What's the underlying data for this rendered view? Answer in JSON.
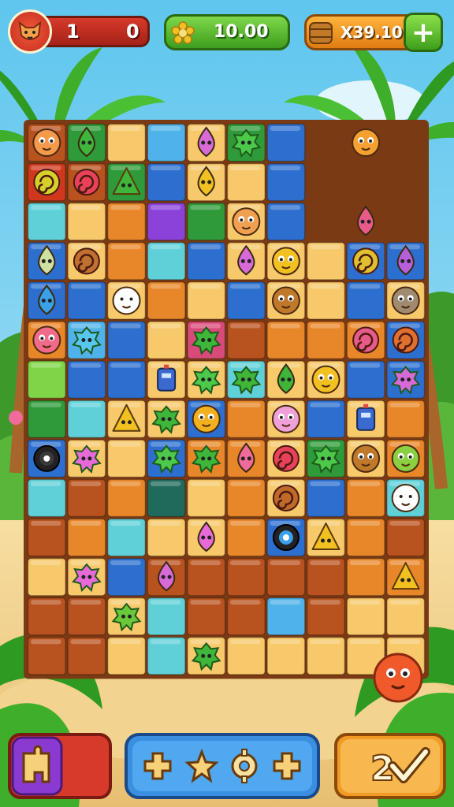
{
  "hud": {
    "player_level": "1",
    "player_score": "0",
    "timer": "10.00",
    "coins": "X39.10",
    "add_label": "+"
  },
  "colors": {
    "sky": "#5fc6ee",
    "sand": "#f2d38f",
    "board_border": "#8a4a1c",
    "accent_red": "#d63a2a",
    "accent_green": "#4fb52a",
    "accent_orange": "#f29b24",
    "accent_blue": "#3a8fe0"
  },
  "board": {
    "cols": 10,
    "rows": 14,
    "tiles": [
      [
        "brick",
        "green",
        "sand",
        "sky",
        "sand",
        "green",
        "blue",
        "empty",
        "empty",
        "empty"
      ],
      [
        "red",
        "brick",
        "green",
        "blue",
        "sand",
        "sand",
        "blue",
        "empty",
        "empty",
        "empty"
      ],
      [
        "cyan",
        "sand",
        "orange",
        "purple",
        "green",
        "sand",
        "blue",
        "empty",
        "empty",
        "empty"
      ],
      [
        "blue",
        "sand",
        "orange",
        "cyan",
        "blue",
        "sand",
        "sand",
        "sand",
        "blue",
        "blue"
      ],
      [
        "blue",
        "blue",
        "sand",
        "orange",
        "sand",
        "blue",
        "sand",
        "sand",
        "blue",
        "sand"
      ],
      [
        "orange",
        "sky",
        "blue",
        "sand",
        "pink",
        "brick",
        "orange",
        "orange",
        "orange",
        "blue"
      ],
      [
        "lime",
        "blue",
        "blue",
        "sand",
        "sand",
        "cyan",
        "sand",
        "sand",
        "blue",
        "blue"
      ],
      [
        "green",
        "cyan",
        "sand",
        "sand",
        "blue",
        "orange",
        "sand",
        "blue",
        "sand",
        "orange"
      ],
      [
        "blue",
        "sand",
        "sand",
        "blue",
        "orange",
        "orange",
        "sand",
        "green",
        "sand",
        "orange"
      ],
      [
        "cyan",
        "brick",
        "orange",
        "teal",
        "sand",
        "orange",
        "sand",
        "blue",
        "orange",
        "cyan"
      ],
      [
        "brick",
        "orange",
        "cyan",
        "sand",
        "sand",
        "orange",
        "blue",
        "sand",
        "orange",
        "brick"
      ],
      [
        "sand",
        "sand",
        "blue",
        "brick",
        "brick",
        "brick",
        "brick",
        "brick",
        "orange",
        "orange"
      ],
      [
        "brick",
        "brick",
        "sand",
        "cyan",
        "brick",
        "brick",
        "sky",
        "brick",
        "sand",
        "sand"
      ],
      [
        "brick",
        "brick",
        "sand",
        "cyan",
        "sand",
        "sand",
        "sand",
        "sand",
        "sand",
        "sand"
      ]
    ],
    "creatures": [
      {
        "c": 0,
        "r": 0,
        "kind": "blob",
        "color": "#f49a4a"
      },
      {
        "c": 1,
        "r": 0,
        "kind": "drop",
        "color": "#3fb53a"
      },
      {
        "c": 4,
        "r": 0,
        "kind": "drop",
        "color": "#d86ad8"
      },
      {
        "c": 5,
        "r": 0,
        "kind": "splat",
        "color": "#4cc84a"
      },
      {
        "c": 8,
        "r": 0,
        "kind": "blob",
        "color": "#f5a030"
      },
      {
        "c": 0,
        "r": 1,
        "kind": "swirl",
        "color": "#d7d02a"
      },
      {
        "c": 1,
        "r": 1,
        "kind": "swirl",
        "color": "#e8425a"
      },
      {
        "c": 2,
        "r": 1,
        "kind": "tri",
        "color": "#3fb53a"
      },
      {
        "c": 4,
        "r": 1,
        "kind": "drop",
        "color": "#f2c021"
      },
      {
        "c": 5,
        "r": 2,
        "kind": "blob",
        "color": "#f0a050"
      },
      {
        "c": 8,
        "r": 2,
        "kind": "drop",
        "color": "#e85a8a"
      },
      {
        "c": 0,
        "r": 3,
        "kind": "drop",
        "color": "#cfe0a0"
      },
      {
        "c": 1,
        "r": 3,
        "kind": "swirl",
        "color": "#c07030"
      },
      {
        "c": 5,
        "r": 3,
        "kind": "drop",
        "color": "#d86ad8"
      },
      {
        "c": 6,
        "r": 3,
        "kind": "blob",
        "color": "#f2c021"
      },
      {
        "c": 8,
        "r": 3,
        "kind": "swirl",
        "color": "#e0c030"
      },
      {
        "c": 9,
        "r": 3,
        "kind": "drop",
        "color": "#b560d8"
      },
      {
        "c": 0,
        "r": 4,
        "kind": "drop",
        "color": "#3aa0e8"
      },
      {
        "c": 2,
        "r": 4,
        "kind": "blob",
        "color": "#ffffff"
      },
      {
        "c": 6,
        "r": 4,
        "kind": "blob",
        "color": "#c0782a"
      },
      {
        "c": 9,
        "r": 4,
        "kind": "blob",
        "color": "#a08a70"
      },
      {
        "c": 0,
        "r": 5,
        "kind": "blob",
        "color": "#f06a8a"
      },
      {
        "c": 1,
        "r": 5,
        "kind": "splat",
        "color": "#56c8f0"
      },
      {
        "c": 4,
        "r": 5,
        "kind": "splat",
        "color": "#3fb53a"
      },
      {
        "c": 8,
        "r": 5,
        "kind": "swirl",
        "color": "#e85a8a"
      },
      {
        "c": 9,
        "r": 5,
        "kind": "swirl",
        "color": "#e07030"
      },
      {
        "c": 3,
        "r": 6,
        "kind": "robot",
        "color": "#3a6ad0"
      },
      {
        "c": 4,
        "r": 6,
        "kind": "splat",
        "color": "#4cc84a"
      },
      {
        "c": 5,
        "r": 6,
        "kind": "splat",
        "color": "#3fb53a"
      },
      {
        "c": 6,
        "r": 6,
        "kind": "drop",
        "color": "#3fb53a"
      },
      {
        "c": 7,
        "r": 6,
        "kind": "blob",
        "color": "#f2c021"
      },
      {
        "c": 9,
        "r": 6,
        "kind": "splat",
        "color": "#d86ad8"
      },
      {
        "c": 2,
        "r": 7,
        "kind": "tri",
        "color": "#f2c021"
      },
      {
        "c": 3,
        "r": 7,
        "kind": "splat",
        "color": "#3fb53a"
      },
      {
        "c": 4,
        "r": 7,
        "kind": "blob",
        "color": "#f2b021"
      },
      {
        "c": 6,
        "r": 7,
        "kind": "blob",
        "color": "#f0a0d8"
      },
      {
        "c": 8,
        "r": 7,
        "kind": "robot",
        "color": "#3a6ad0"
      },
      {
        "c": 0,
        "r": 8,
        "kind": "eye",
        "color": "#3a3a3a"
      },
      {
        "c": 1,
        "r": 8,
        "kind": "splat",
        "color": "#e86ad8"
      },
      {
        "c": 3,
        "r": 8,
        "kind": "splat",
        "color": "#4cc84a"
      },
      {
        "c": 4,
        "r": 8,
        "kind": "splat",
        "color": "#3fb53a"
      },
      {
        "c": 5,
        "r": 8,
        "kind": "drop",
        "color": "#f06a9a"
      },
      {
        "c": 6,
        "r": 8,
        "kind": "swirl",
        "color": "#e8425a"
      },
      {
        "c": 7,
        "r": 8,
        "kind": "splat",
        "color": "#4cc84a"
      },
      {
        "c": 8,
        "r": 8,
        "kind": "blob",
        "color": "#c0782a"
      },
      {
        "c": 9,
        "r": 8,
        "kind": "blob",
        "color": "#8ad040"
      },
      {
        "c": 6,
        "r": 9,
        "kind": "swirl",
        "color": "#c06a2a"
      },
      {
        "c": 9,
        "r": 9,
        "kind": "blob",
        "color": "#ffffff"
      },
      {
        "c": 4,
        "r": 10,
        "kind": "drop",
        "color": "#e86ad8"
      },
      {
        "c": 6,
        "r": 10,
        "kind": "eye",
        "color": "#3aa0e8"
      },
      {
        "c": 7,
        "r": 10,
        "kind": "tri",
        "color": "#f2c021"
      },
      {
        "c": 1,
        "r": 11,
        "kind": "splat",
        "color": "#e86ad8"
      },
      {
        "c": 3,
        "r": 11,
        "kind": "drop",
        "color": "#d86ad8"
      },
      {
        "c": 9,
        "r": 11,
        "kind": "tri",
        "color": "#f2c021"
      },
      {
        "c": 2,
        "r": 12,
        "kind": "splat",
        "color": "#6ac83a"
      },
      {
        "c": 4,
        "r": 13,
        "kind": "splat",
        "color": "#3fb53a"
      }
    ]
  },
  "decor": {
    "extra_creature_color": "#f05a2a"
  },
  "buttons": {
    "left_icon": "puzzle-piece-icon",
    "center_icons": [
      "plus-sparkle-icon",
      "star-sparkle-icon",
      "gear-sparkle-icon",
      "plus-sparkle-icon"
    ],
    "right_label": "2",
    "right_icon": "check-icon"
  }
}
